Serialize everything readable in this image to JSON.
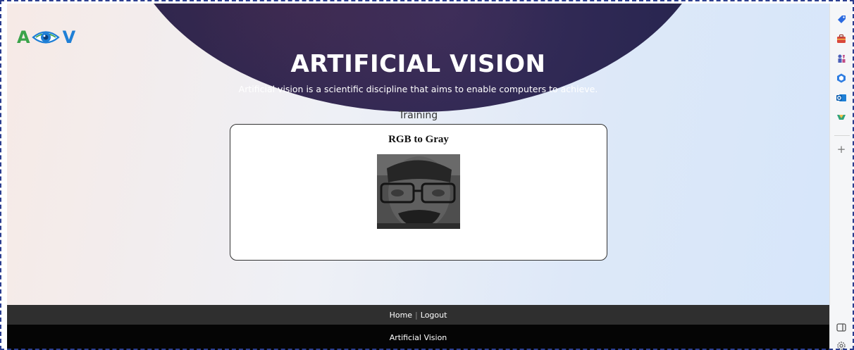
{
  "logo": {
    "left": "A",
    "right": "V",
    "icon": "eye-icon"
  },
  "hero": {
    "title": "ARTIFICIAL VISION",
    "subtitle": "Artificial vision is a scientific discipline that aims to enable computers to achieve."
  },
  "section": {
    "label": "Training"
  },
  "card": {
    "title": "RGB to Gray",
    "image": "grayscale-face-photo"
  },
  "footer": {
    "nav": [
      {
        "label": "Home"
      },
      {
        "label": "Logout"
      }
    ],
    "separator": "|",
    "bottom_text": "Artificial Vision"
  },
  "sidebar": {
    "icons": [
      "tag-icon",
      "briefcase-icon",
      "chess-pieces-icon",
      "copilot-icon",
      "outlook-icon",
      "shopping-icon"
    ],
    "add_icon": "plus-icon",
    "add_label": "+",
    "bottom_icons": [
      "panel-icon",
      "settings-icon"
    ]
  },
  "colors": {
    "hero_bg": "#27254f",
    "logo_a": "#3aa34a",
    "logo_v": "#1f7fd6",
    "footer_nav_bg": "#2f2f2f",
    "footer_bottom_bg": "#050505"
  }
}
